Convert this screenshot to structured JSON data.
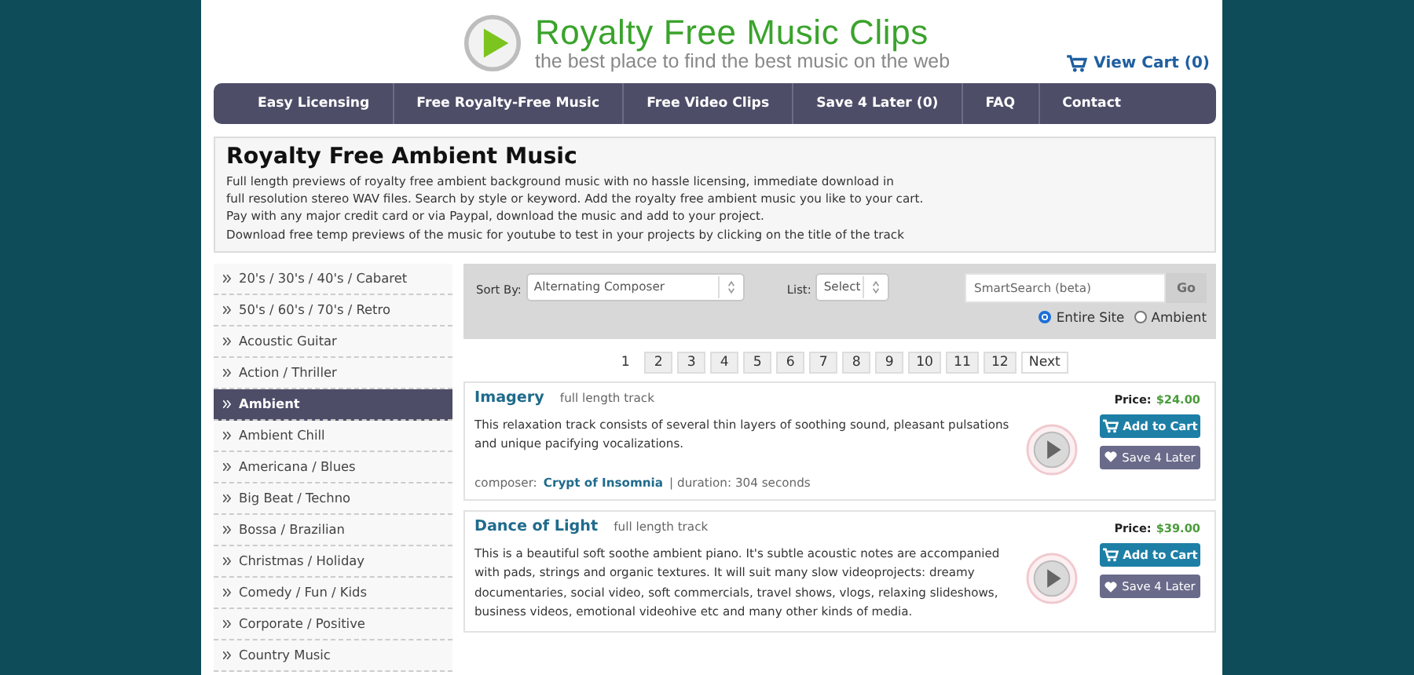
{
  "header": {
    "logo_title": "Royalty Free Music Clips",
    "tagline": "the best place to find the best music on the web",
    "cart": "View Cart (0)"
  },
  "nav": [
    "Easy Licensing",
    "Free Royalty-Free Music",
    "Free Video Clips",
    "Save 4 Later (0)",
    "FAQ",
    "Contact"
  ],
  "intro": {
    "title": "Royalty Free Ambient Music",
    "lines": [
      "Full length previews of royalty free ambient background music with no hassle licensing, immediate download in",
      "full resolution stereo WAV files. Search by style or keyword. Add the royalty free ambient music you like to your cart.",
      "Pay with any major credit card or via Paypal, download the music and add to your project.",
      "Download free temp previews of the music for youtube to test in your projects by clicking on the title of the track"
    ]
  },
  "sidebar": {
    "items": [
      {
        "label": "20's / 30's / 40's / Cabaret",
        "selected": false
      },
      {
        "label": "50's / 60's / 70's / Retro",
        "selected": false
      },
      {
        "label": "Acoustic Guitar",
        "selected": false
      },
      {
        "label": "Action / Thriller",
        "selected": false
      },
      {
        "label": "Ambient",
        "selected": true
      },
      {
        "label": "Ambient Chill",
        "selected": false
      },
      {
        "label": "Americana / Blues",
        "selected": false
      },
      {
        "label": "Big Beat / Techno",
        "selected": false
      },
      {
        "label": "Bossa / Brazilian",
        "selected": false
      },
      {
        "label": "Christmas / Holiday",
        "selected": false
      },
      {
        "label": "Comedy / Fun / Kids",
        "selected": false
      },
      {
        "label": "Corporate / Positive",
        "selected": false
      },
      {
        "label": "Country Music",
        "selected": false
      }
    ]
  },
  "toolbar": {
    "sort_label": "Sort By:",
    "sort_value": "Alternating Composer",
    "list_label": "List:",
    "list_value": "Select",
    "search": {
      "placeholder": "SmartSearch (beta)",
      "button": "Go"
    },
    "scope": [
      {
        "label": "Entire Site",
        "selected": true
      },
      {
        "label": "Ambient",
        "selected": false
      }
    ]
  },
  "pagination": [
    {
      "label": "1",
      "selected": true
    },
    {
      "label": "2",
      "selected": false
    },
    {
      "label": "3",
      "selected": false
    },
    {
      "label": "4",
      "selected": false
    },
    {
      "label": "5",
      "selected": false
    },
    {
      "label": "6",
      "selected": false
    },
    {
      "label": "7",
      "selected": false
    },
    {
      "label": "8",
      "selected": false
    },
    {
      "label": "9",
      "selected": false
    },
    {
      "label": "10",
      "selected": false
    },
    {
      "label": "11",
      "selected": false
    },
    {
      "label": "12",
      "selected": false
    },
    {
      "label": "Next",
      "selected": false
    }
  ],
  "tracks": [
    {
      "title": "Imagery",
      "subtitle": "full length track",
      "description": "This relaxation track consists of several thin layers of soothing sound, pleasant pulsations and unique pacifying vocalizations.",
      "price_label": "Price:",
      "price": "$24.00",
      "composer_label": "composer:",
      "composer": "Crypt of Insomnia",
      "duration": "| duration: 304 seconds",
      "add_button": "Add to Cart",
      "save_button": "Save 4 Later"
    },
    {
      "title": "Dance of Light",
      "subtitle": "full length track",
      "description": "This is a beautiful soft soothe ambient piano. It's subtle acoustic notes are accompanied with pads, strings and organic textures. It will suit many slow videoprojects: dreamy documentaries, social video, soft commercials, travel shows, vlogs, relaxing slideshows, business videos, emotional videohive etc and many other kinds of media.",
      "price_label": "Price:",
      "price": "$39.00",
      "add_button": "Add to Cart",
      "save_button": "Save 4 Later"
    }
  ]
}
